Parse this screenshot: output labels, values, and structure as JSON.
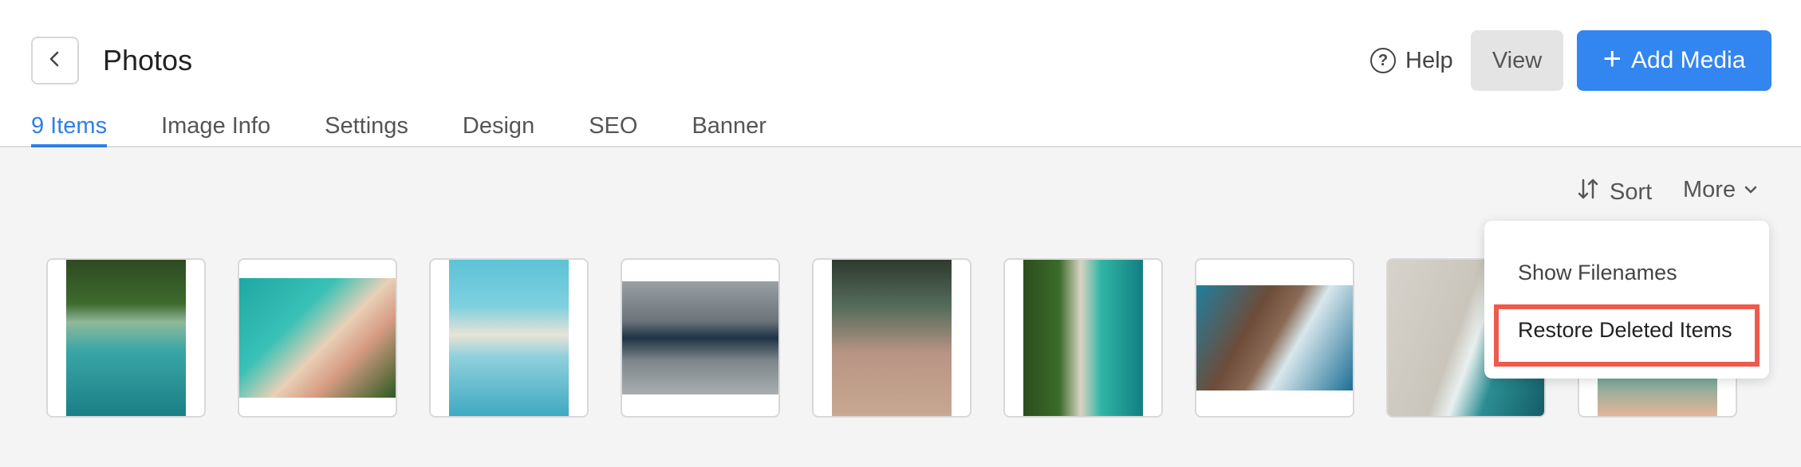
{
  "header": {
    "title": "Photos",
    "help_label": "Help",
    "view_label": "View",
    "add_media_label": "Add Media"
  },
  "tabs": [
    {
      "label": "9 Items",
      "active": true
    },
    {
      "label": "Image Info",
      "active": false
    },
    {
      "label": "Settings",
      "active": false
    },
    {
      "label": "Design",
      "active": false
    },
    {
      "label": "SEO",
      "active": false
    },
    {
      "label": "Banner",
      "active": false
    }
  ],
  "toolbar": {
    "sort_label": "Sort",
    "more_label": "More"
  },
  "more_menu": {
    "items": [
      "Show Filenames",
      "Restore Deleted Items"
    ],
    "highlighted": "Restore Deleted Items"
  },
  "colors": {
    "accent": "#3385f0",
    "highlight_border": "#ef5a4d"
  },
  "icons": [
    "back-arrow-icon",
    "help-circle-icon",
    "plus-icon",
    "sort-arrows-icon",
    "chevron-down-icon"
  ]
}
